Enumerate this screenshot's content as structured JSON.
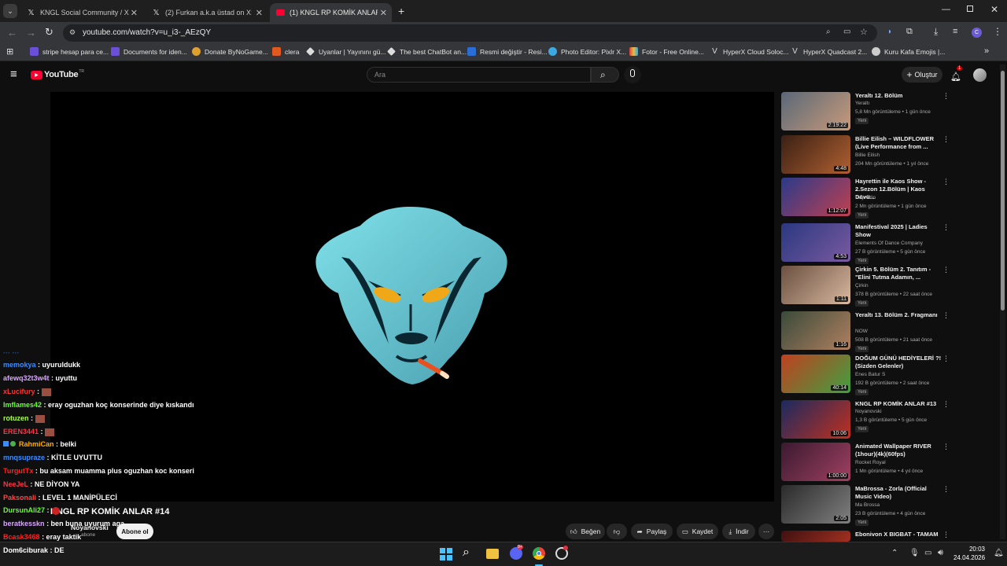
{
  "browser": {
    "tabs": [
      {
        "label": "KNGL Social Community / X",
        "icon": "x-icon"
      },
      {
        "label": "(2) Furkan a.k.a üstad on X: \"Yo",
        "icon": "x-icon"
      },
      {
        "label": "(1) KNGL RP KOMİK ANLAR #14",
        "icon": "youtube-icon"
      }
    ],
    "url": "youtube.com/watch?v=u_i3-_AEzQY",
    "bookmarks": [
      "stripe hesap para ce...",
      "Documents for iden...",
      "Donate ByNoGame...",
      "clera",
      "Uyanlar | Yayınını gü...",
      "The best ChatBot an...",
      "Resmi değiştir - Resi...",
      "Photo Editor: Pixlr X...",
      "Fotor - Free Online...",
      "HyperX Cloud Soloc...",
      "HyperX Quadcast 2...",
      "Kuru Kafa Emojis |..."
    ]
  },
  "youtube": {
    "logo": "YouTube",
    "logo_country": "TR",
    "search_placeholder": "Ara",
    "create_label": "Oluştur",
    "notif_count": "1"
  },
  "chat": [
    {
      "user": "memokya",
      "msg": ": uyuruldukk",
      "color": "#3b8cff"
    },
    {
      "user": "afewq32t3w4t",
      "msg": ": uyuttu",
      "color": "#d8a6ff"
    },
    {
      "user": "xLucifury",
      "msg": ":",
      "color": "#ff3333"
    },
    {
      "user": "Imflames42",
      "msg": ": eray oguzhan koç konserinde diye kıskandı",
      "color": "#66ff33"
    },
    {
      "user": "rotuzen",
      "msg": ":",
      "color": "#aaff44"
    },
    {
      "user": "EREN3441",
      "msg": ":",
      "color": "#ff3344"
    },
    {
      "user": "RahmiCan",
      "msg": ": belki",
      "color": "#ffaa00"
    },
    {
      "user": "mnqsupraze",
      "msg": ": KİTLE UYUTTU",
      "color": "#3b8cff"
    },
    {
      "user": "TurgutTx",
      "msg": ": bu aksam muamma plus oguzhan koc konseri",
      "color": "#ff2222"
    },
    {
      "user": "NeeJeL",
      "msg": ": NE DİYON YA",
      "color": "#ff3344"
    },
    {
      "user": "Paksonali",
      "msg": ": LEVEL 1 MANİPÜLECİ",
      "color": "#ff4444"
    },
    {
      "user": "DursunAli27",
      "msg": ":",
      "color": "#66ff33"
    },
    {
      "user": "beratkesskn",
      "msg": ": ben buna uyurum aga",
      "color": "#d8a6ff"
    },
    {
      "user": "Bcask3468",
      "msg": ": eray taktik",
      "color": "#ff2222"
    },
    {
      "user": "Dom6ciburak",
      "msg": ": DE",
      "color": "#ffffff"
    }
  ],
  "video": {
    "title": "KNGL RP KOMİK ANLAR #14",
    "channel": "Noyanovski",
    "subs": "abone",
    "subscribe": "Abone ol",
    "like": "Beğen",
    "share": "Paylaş",
    "save": "Kaydet",
    "download": "İndir"
  },
  "recs": [
    {
      "title": "Yeraltı 12. Bölüm",
      "channel": "Yeraltı",
      "meta": "5,8 Mn görüntüleme • 1 gün önce",
      "badge": "Yeni",
      "dur": "2:19:22",
      "c1": "#5a6878",
      "c2": "#c89a7a"
    },
    {
      "title": "Billie Eilish – WILDFLOWER (Live Performance from ...",
      "channel": "Billie Eilish",
      "meta": "204 Mn görüntüleme • 1 yıl önce",
      "badge": "",
      "dur": "4:48",
      "c1": "#3a2015",
      "c2": "#b06030"
    },
    {
      "title": "Hayrettin ile Kaos Show - 2.Sezon 12.Bölüm | Kaos Dövü...",
      "channel": "Hayrettin",
      "meta": "2 Mn görüntüleme • 1 gün önce",
      "badge": "Yeni",
      "dur": "1:12:07",
      "c1": "#2a3a8a",
      "c2": "#c04050"
    },
    {
      "title": "Manifestival 2025 | Ladies Show",
      "channel": "Elements Of Dance Company",
      "meta": "27 B görüntüleme • 5 gün önce",
      "badge": "Yeni",
      "dur": "4:53",
      "c1": "#2a3880",
      "c2": "#7a5aa0"
    },
    {
      "title": "Çirkin 5. Bölüm 2. Tanıtım - \"Elini Tutma Adamın, ...",
      "channel": "Çirkin",
      "meta": "378 B görüntüleme • 22 saat önce",
      "badge": "Yeni",
      "dur": "1:11",
      "c1": "#6a5040",
      "c2": "#d8b8a0"
    },
    {
      "title": "Yeraltı 13. Bölüm 2. Fragmanı",
      "channel": "NOW",
      "meta": "508 B görüntüleme • 21 saat önce",
      "badge": "Yeni",
      "dur": "1:16",
      "c1": "#3a4a3a",
      "c2": "#b08060"
    },
    {
      "title": "DOĞUM GÜNÜ HEDİYELERİ ?! (Sizden Gelenler)",
      "channel": "Enes Batur S",
      "meta": "192 B görüntüleme • 2 saat önce",
      "badge": "Yeni",
      "dur": "40:14",
      "c1": "#c04020",
      "c2": "#40a040"
    },
    {
      "title": "KNGL RP KOMİK ANLAR #13",
      "channel": "Noyanovski",
      "meta": "1,3 B görüntüleme • 5 gün önce",
      "badge": "Yeni",
      "dur": "10:06",
      "c1": "#1a2a60",
      "c2": "#c03020"
    },
    {
      "title": "Animated Wallpaper RIVER (1hour)(4k)(60fps)",
      "channel": "Rocket Royal",
      "meta": "1 Mn görüntüleme • 4 yıl önce",
      "badge": "",
      "dur": "1:00:00",
      "c1": "#3a1a30",
      "c2": "#a04060"
    },
    {
      "title": "MaBrossa - Zorla  (Official Music Video)",
      "channel": "Ma Brossa",
      "meta": "23 B görüntüleme • 4 gün önce",
      "badge": "Yeni",
      "dur": "2:05",
      "c1": "#2a2a2a",
      "c2": "#808080"
    },
    {
      "title": "Ebonivon X BIGBAT - TAMAM",
      "channel": "",
      "meta": "",
      "badge": "",
      "dur": "",
      "c1": "#401010",
      "c2": "#a03020"
    }
  ],
  "taskbar": {
    "time": "20:03",
    "date": "24.04.2026",
    "discord_badge": "9+"
  }
}
